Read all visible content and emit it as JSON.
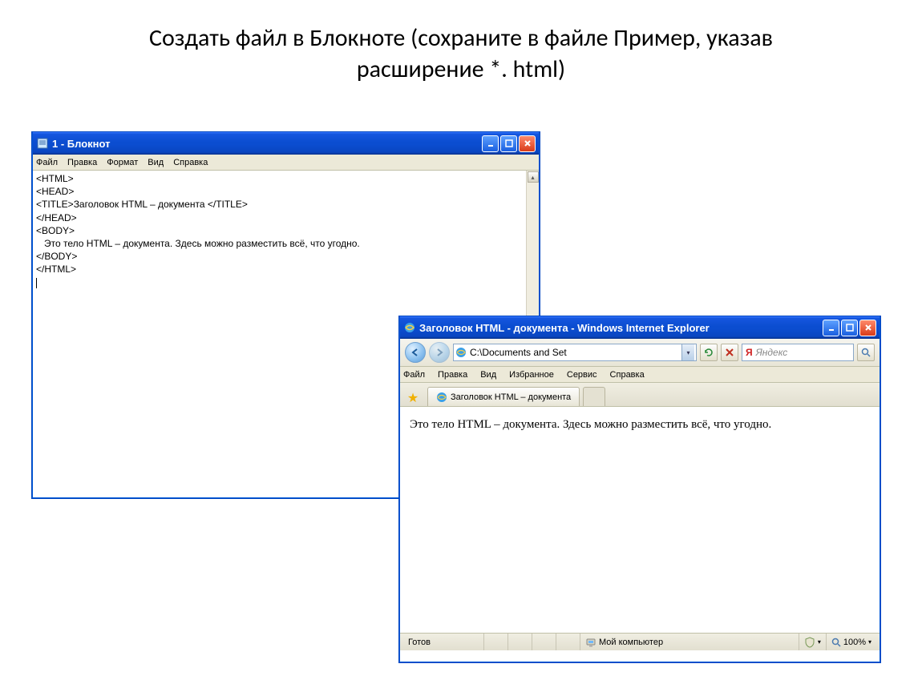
{
  "heading_line1": "Создать файл в Блокноте (сохраните в файле  Пример,  указав",
  "heading_line2": "расширение  *. html)",
  "notepad": {
    "title": "1 - Блокнот",
    "menu": [
      "Файл",
      "Правка",
      "Формат",
      "Вид",
      "Справка"
    ],
    "lines": [
      "<HTML>",
      "<HEAD>",
      "<TITLE>Заголовок HTML – документа </TITLE>",
      "</HEAD>",
      "<BODY>",
      "   Это тело HTML – документа. Здесь можно разместить всё, что угодно.",
      "</BODY>",
      "</HTML>"
    ]
  },
  "ie": {
    "title": "Заголовок HTML - документа - Windows Internet Explorer",
    "address": "C:\\Documents and Set",
    "search_placeholder": "Яндекс",
    "menu": [
      "Файл",
      "Правка",
      "Вид",
      "Избранное",
      "Сервис",
      "Справка"
    ],
    "tab_label": "Заголовок HTML – документа",
    "body_text": "Это тело HTML – документа. Здесь можно разместить всё, что угодно.",
    "status_ready": "Готов",
    "status_zone": "Мой компьютер",
    "status_zoom": "100%"
  }
}
